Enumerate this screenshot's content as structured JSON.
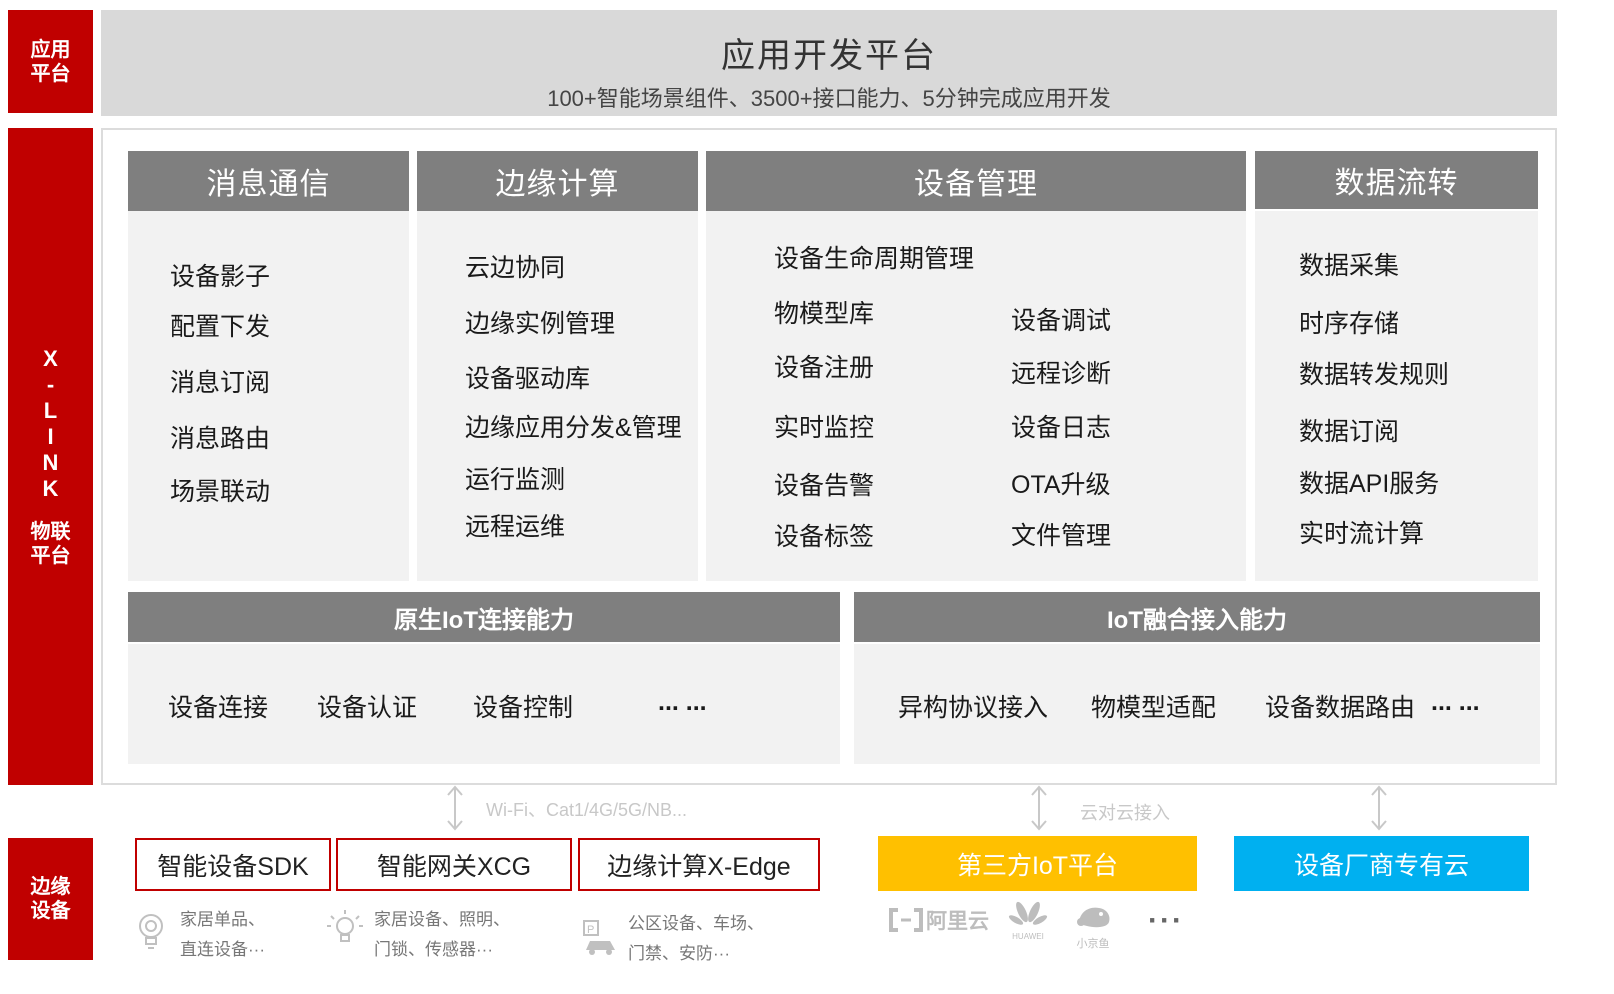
{
  "side": {
    "app_line1": "应用",
    "app_line2": "平台",
    "xlink_letters": [
      "X",
      "-",
      "L",
      "I",
      "N",
      "K"
    ],
    "xlink_line1": "物联",
    "xlink_line2": "平台",
    "edge_line1": "边缘",
    "edge_line2": "设备"
  },
  "app": {
    "title": "应用开发平台",
    "subtitle": "100+智能场景组件、3500+接口能力、5分钟完成应用开发"
  },
  "columns": {
    "messaging": {
      "title": "消息通信",
      "items": [
        "设备影子",
        "配置下发",
        "消息订阅",
        "消息路由",
        "场景联动"
      ]
    },
    "edge": {
      "title": "边缘计算",
      "items": [
        "云边协同",
        "边缘实例管理",
        "设备驱动库",
        "边缘应用分发&管理",
        "运行监测",
        "远程运维"
      ]
    },
    "device": {
      "title": "设备管理",
      "top": "设备生命周期管理",
      "left": [
        "物模型库",
        "设备注册",
        "实时监控",
        "设备告警",
        "设备标签"
      ],
      "right": [
        "设备调试",
        "远程诊断",
        "设备日志",
        "OTA升级",
        "文件管理"
      ]
    },
    "data": {
      "title": "数据流转",
      "items": [
        "数据采集",
        "时序存储",
        "数据转发规则",
        "数据订阅",
        "数据API服务",
        "实时流计算"
      ]
    }
  },
  "capabilities": {
    "native": {
      "title": "原生IoT连接能力",
      "items": [
        "设备连接",
        "设备认证",
        "设备控制",
        "... ..."
      ]
    },
    "fusion": {
      "title": "IoT融合接入能力",
      "items": [
        "异构协议接入",
        "物模型适配",
        "设备数据路由",
        "... ..."
      ]
    }
  },
  "links": {
    "left_label": "Wi-Fi、Cat1/4G/5G/NB...",
    "mid_label": "云对云接入"
  },
  "bottom": {
    "sdk": "智能设备SDK",
    "gateway": "智能网关XCG",
    "edge": "边缘计算X-Edge",
    "third_party": "第三方IoT平台",
    "vendor_cloud": "设备厂商专有云",
    "desc1_line1": "家居单品、",
    "desc1_line2": "直连设备···",
    "desc2_line1": "家居设备、照明、",
    "desc2_line2": "门锁、传感器···",
    "desc3_line1": "公区设备、车场、",
    "desc3_line2": "门禁、安防···",
    "logo_aliyun": "阿里云",
    "logo_huawei": "HUAWEI",
    "logo_xiaojingyu": "小京鱼",
    "more": "···"
  },
  "colors": {
    "red": "#c00000",
    "gray_head": "#7f7f7f",
    "light_bg": "#f2f2f2",
    "yellow": "#ffc000",
    "blue": "#00b0f0"
  }
}
